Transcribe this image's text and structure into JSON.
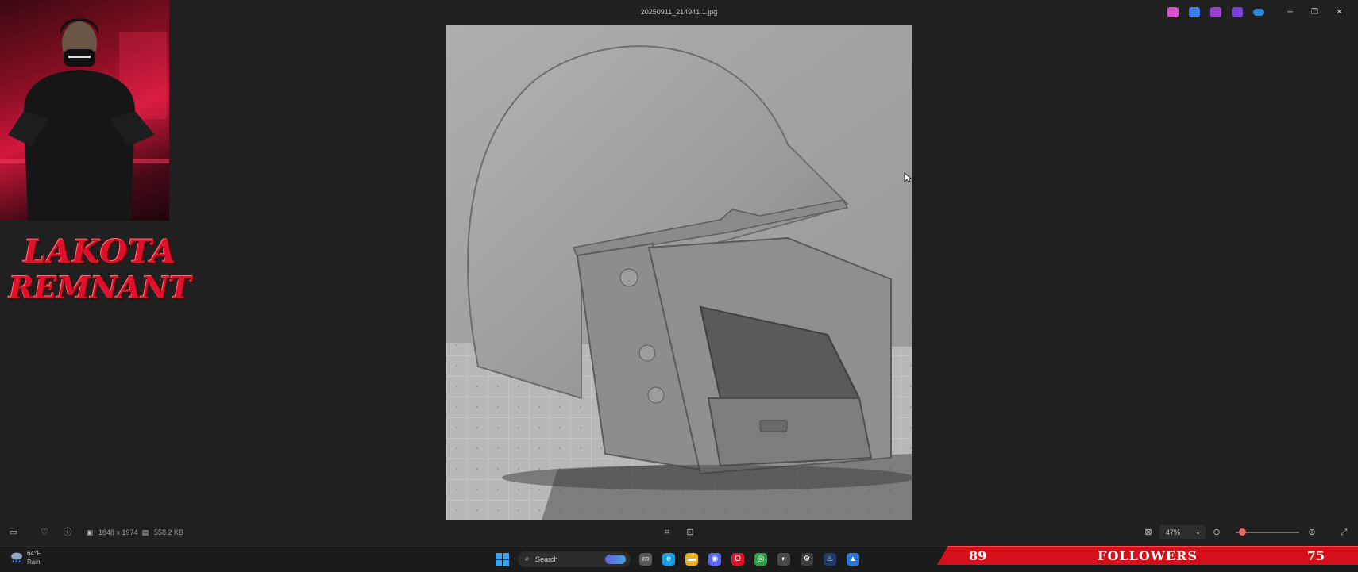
{
  "window": {
    "title": "20250911_214941 1.jpg",
    "controls": [
      "─",
      "❐",
      "✕"
    ],
    "title_app_icons": [
      {
        "name": "copilot-icon",
        "color": "#d94fd0"
      },
      {
        "name": "designer-icon",
        "color": "#3f7ee8"
      },
      {
        "name": "clipchamp-icon",
        "color": "#9b3fd0"
      },
      {
        "name": "video-editor-icon",
        "color": "#7b3fe0"
      },
      {
        "name": "onedrive-icon",
        "color": "#2a8ae0"
      }
    ]
  },
  "viewer_bar": {
    "dimensions": "1848 x 1974",
    "file_size": "558.2 KB",
    "zoom": "47%",
    "zoom_level": 0.1
  },
  "taskbar": {
    "weather_temp": "64°F",
    "weather_condition": "Rain",
    "search_placeholder": "Search",
    "icons": [
      {
        "name": "task-view-icon",
        "color": "#5a5a5a",
        "glyph": "▭"
      },
      {
        "name": "edge-icon",
        "color": "#1b9de2",
        "glyph": "e"
      },
      {
        "name": "file-explorer-icon",
        "color": "#e8b21f",
        "glyph": "▬"
      },
      {
        "name": "discord-icon",
        "color": "#5865f2",
        "glyph": "◉"
      },
      {
        "name": "opera-icon",
        "color": "#e0142b",
        "glyph": "O"
      },
      {
        "name": "chrome-icon",
        "color": "#2e9e48",
        "glyph": "◎"
      },
      {
        "name": "obs-icon",
        "color": "#4a4a4a",
        "glyph": "◐"
      },
      {
        "name": "settings-icon",
        "color": "#3c3c3c",
        "glyph": "⚙"
      },
      {
        "name": "steam-icon",
        "color": "#1e3b6a",
        "glyph": "♨"
      },
      {
        "name": "photos-icon",
        "color": "#2b78d4",
        "glyph": "▲"
      }
    ]
  },
  "overlay": {
    "logo_line1": "LAKOTA",
    "logo_line2": "REMNANT",
    "followers_count_left": "89",
    "followers_label": "FOLLOWERS",
    "followers_count_right": "75"
  },
  "colors": {
    "accent_red": "#d5101a",
    "background": "#202020"
  }
}
